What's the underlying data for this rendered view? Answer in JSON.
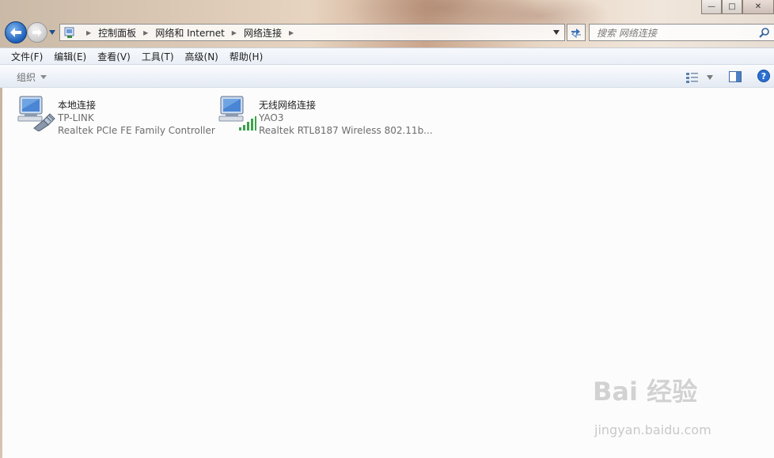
{
  "window": {
    "controls": {
      "minimize": "—",
      "maximize": "□",
      "close": "✕"
    }
  },
  "address": {
    "crumbs": [
      "控制面板",
      "网络和 Internet",
      "网络连接"
    ]
  },
  "search": {
    "placeholder": "搜索 网络连接"
  },
  "menu": {
    "items": [
      "文件(F)",
      "编辑(E)",
      "查看(V)",
      "工具(T)",
      "高级(N)",
      "帮助(H)"
    ]
  },
  "toolbar": {
    "organize_label": "组织"
  },
  "connections": [
    {
      "name": "本地连接",
      "network": "TP-LINK",
      "adapter": "Realtek PCIe FE Family Controller",
      "type": "wired"
    },
    {
      "name": "无线网络连接",
      "network": "YAO3",
      "adapter": "Realtek RTL8187 Wireless 802.11b...",
      "type": "wireless"
    }
  ],
  "watermark": {
    "brand": "Bai 经验",
    "url": "jingyan.baidu.com"
  },
  "colors": {
    "signal_green": "#3aa34a",
    "back_button": "#1d5fb8",
    "help_icon": "#2a6fd1"
  },
  "icons": [
    "back-arrow-icon",
    "forward-arrow-icon",
    "control-panel-icon",
    "refresh-icon",
    "search-icon",
    "view-options-icon",
    "preview-pane-icon",
    "help-icon",
    "network-computer-icon",
    "ethernet-plug-icon",
    "signal-bars-icon"
  ]
}
